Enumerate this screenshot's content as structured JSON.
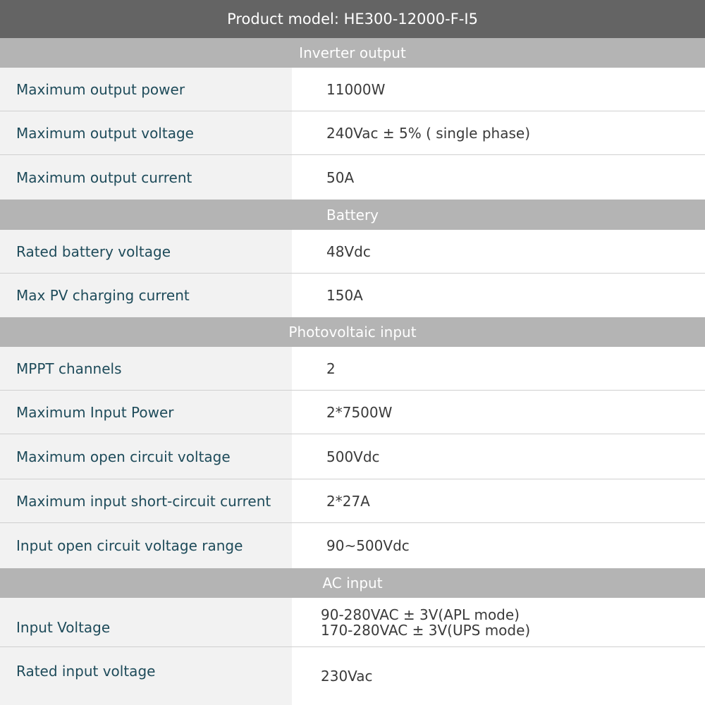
{
  "title": "Product model: HE300-12000-F-I5",
  "sections": [
    {
      "name": "Inverter output"
    },
    {
      "name": "Battery"
    },
    {
      "name": "Photovoltaic input"
    },
    {
      "name": "AC input"
    }
  ],
  "rows": [
    {
      "label": "Maximum output power",
      "value": "11000W"
    },
    {
      "label": "Maximum output voltage",
      "value": "240Vac ± 5% ( single phase)"
    },
    {
      "label": "Maximum output current",
      "value": "50A"
    },
    {
      "label": "Rated battery voltage",
      "value": "48Vdc"
    },
    {
      "label": "Max PV charging current",
      "value": "150A"
    },
    {
      "label": "MPPT channels",
      "value": "2"
    },
    {
      "label": "Maximum Input Power",
      "value": "2*7500W"
    },
    {
      "label": "Maximum open circuit voltage",
      "value": "500Vdc"
    },
    {
      "label": "Maximum input short-circuit current",
      "value": "2*27A"
    },
    {
      "label": "Input open circuit voltage range",
      "value": "90~500Vdc"
    },
    {
      "label": "Input Voltage",
      "value_lines": [
        "90-280VAC ± 3V(APL mode)",
        "170-280VAC ± 3V(UPS mode)"
      ]
    },
    {
      "label": "Rated input voltage",
      "value": "230Vac"
    }
  ]
}
